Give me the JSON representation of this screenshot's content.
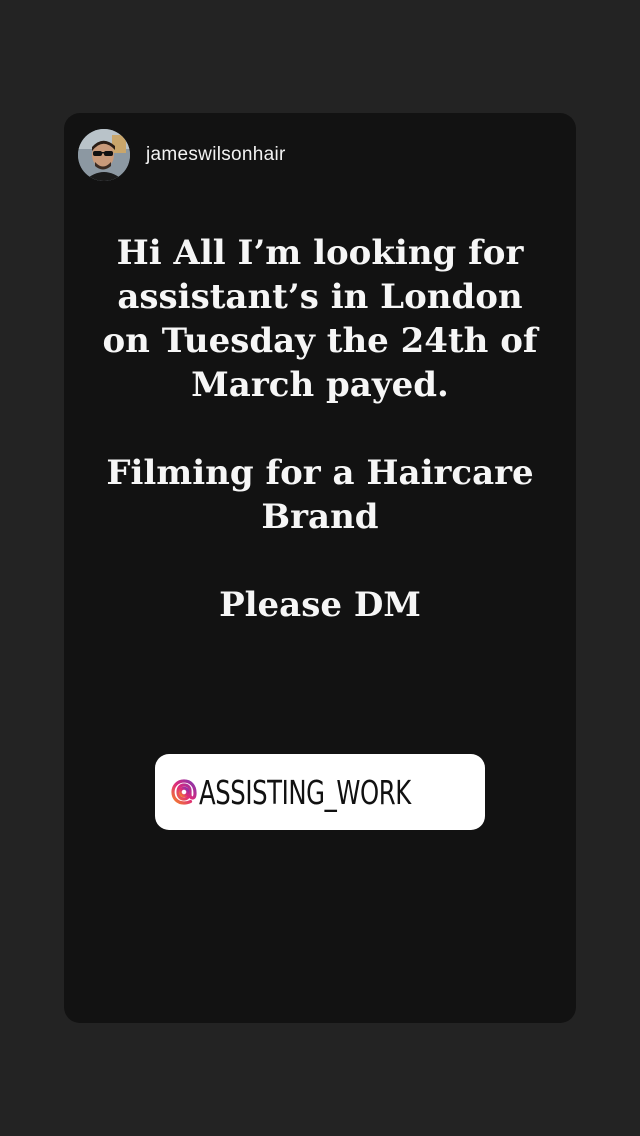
{
  "story": {
    "username": "jameswilsonhair",
    "message": {
      "paragraph_1": "Hi All I’m looking for\nassistant’s in London\non Tuesday the 24th of\nMarch payed.",
      "paragraph_2": "Filming for a Haircare\nBrand",
      "paragraph_3": "Please DM"
    },
    "mention_sticker": {
      "text": "ASSISTING_WORK",
      "icon": "threads-at-icon"
    }
  },
  "colors": {
    "page_background": "#232323",
    "card_background": "#121212",
    "text": "#f6f6f6",
    "sticker_background": "#ffffff",
    "sticker_icon_gradient": [
      "#f58529",
      "#dd2a7b",
      "#8134af"
    ]
  }
}
